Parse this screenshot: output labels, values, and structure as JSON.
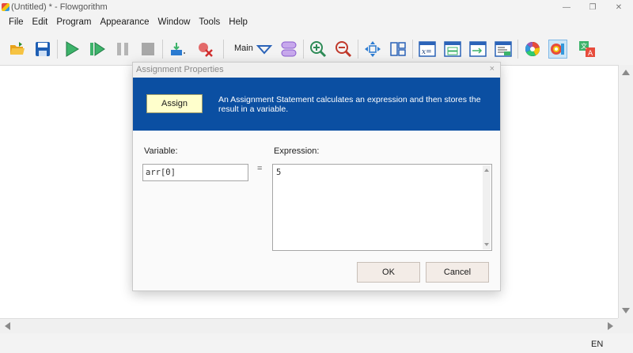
{
  "window": {
    "title": "(Untitled) * - Flowgorithm",
    "minimize_glyph": "—",
    "restore_glyph": "❐",
    "close_glyph": "✕"
  },
  "menu": [
    "File",
    "Edit",
    "Program",
    "Appearance",
    "Window",
    "Tools",
    "Help"
  ],
  "toolbar": {
    "function_label": "Main",
    "icons": [
      "open-folder-icon",
      "save-icon",
      "run-icon",
      "step-icon",
      "pause-icon",
      "stop-icon",
      "breakpoint-icon",
      "clear-breakpoints-icon",
      "function-dropdown-icon",
      "function-manager-icon",
      "zoom-in-icon",
      "zoom-out-icon",
      "move-icon",
      "layout-icon",
      "variable-watch-icon",
      "console-icon",
      "output-icon",
      "source-code-icon",
      "color-wheel-icon",
      "style-icon",
      "translate-icon"
    ]
  },
  "dialog": {
    "title": "Assignment Properties",
    "close_glyph": "×",
    "shape_label": "Assign",
    "description": "An Assignment Statement calculates an expression and then stores the result in a variable.",
    "variable_label": "Variable:",
    "variable_value": "arr[0]",
    "equals": "=",
    "expression_label": "Expression:",
    "expression_value": "5",
    "ok_label": "OK",
    "cancel_label": "Cancel"
  },
  "colors": {
    "banner": "#0b4fa2",
    "assign_fill": "#ffffcc"
  },
  "status": {
    "language": "EN"
  }
}
